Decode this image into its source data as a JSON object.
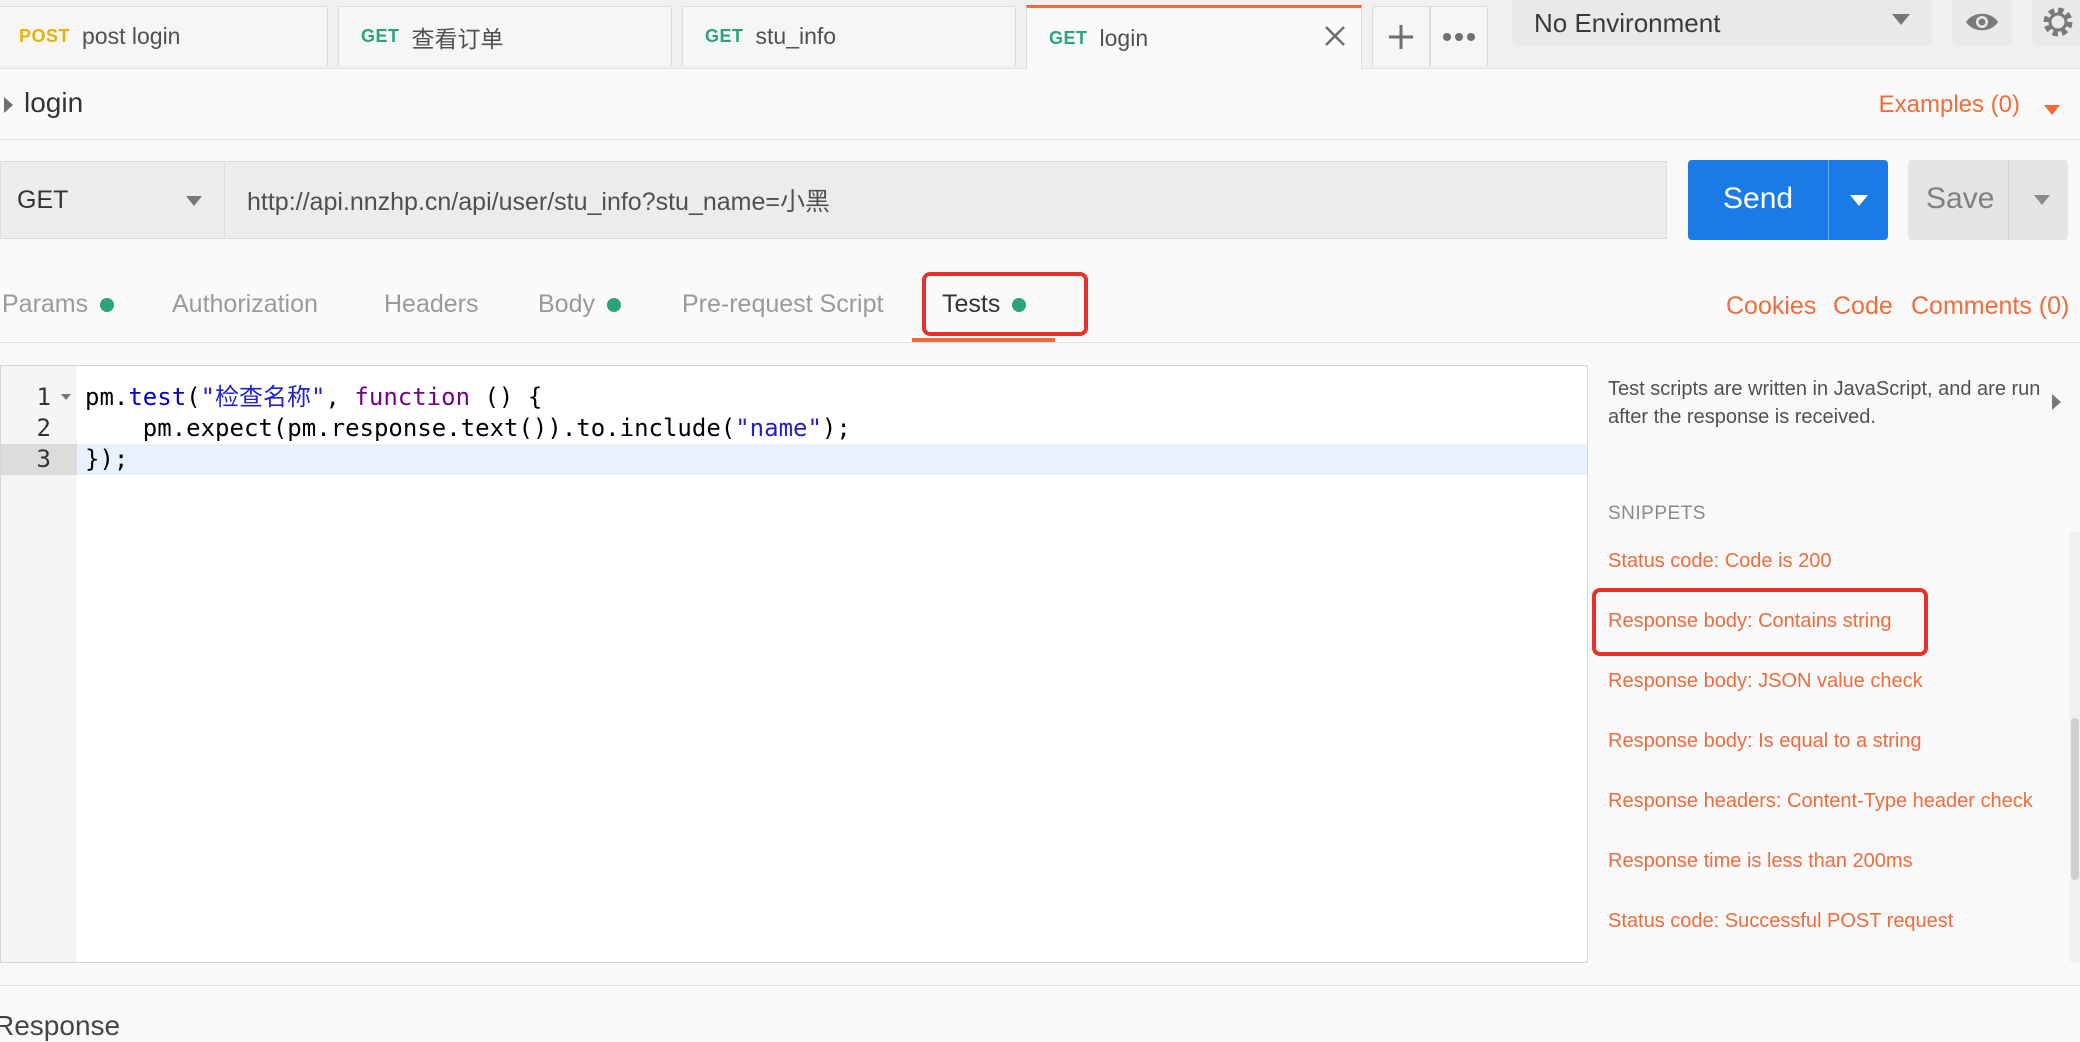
{
  "tabs": [
    {
      "method": "POST",
      "label": "post login"
    },
    {
      "method": "GET",
      "label": "查看订单"
    },
    {
      "method": "GET",
      "label": "stu_info"
    },
    {
      "method": "GET",
      "label": "login"
    }
  ],
  "environment": {
    "selected": "No Environment"
  },
  "request": {
    "title": "login",
    "examples_label": "Examples (0)",
    "method": "GET",
    "url": "http://api.nnzhp.cn/api/user/stu_info?stu_name=小黑",
    "send_label": "Send",
    "save_label": "Save"
  },
  "subtabs": {
    "params": "Params",
    "authorization": "Authorization",
    "headers": "Headers",
    "body": "Body",
    "prerequest": "Pre-request Script",
    "tests": "Tests",
    "cookies": "Cookies",
    "code": "Code",
    "comments": "Comments (0)"
  },
  "editor": {
    "line_numbers": [
      "1",
      "2",
      "3"
    ],
    "line1": {
      "obj": "pm.",
      "fn": "test",
      "open": "(",
      "str": "\"检查名称\"",
      "comma": ", ",
      "kw": "function",
      "rest": " () {"
    },
    "line2": {
      "pre": "    pm.expect(pm.response.text()).to.include(",
      "str": "\"name\"",
      "post": ");"
    },
    "line3": {
      "text": "});"
    }
  },
  "snippets": {
    "help": "Test scripts are written in JavaScript, and are run after the response is received.",
    "header": "SNIPPETS",
    "items": [
      "Status code: Code is 200",
      "Response body: Contains string",
      "Response body: JSON value check",
      "Response body: Is equal to a string",
      "Response headers: Content-Type header check",
      "Response time is less than 200ms",
      "Status code: Successful POST request"
    ]
  },
  "response": {
    "label": "Response"
  },
  "colors": {
    "accent": "#f26b3a",
    "send": "#1a7be6",
    "get": "#2ba47d",
    "post": "#e4b308",
    "highlight": "#e8312a"
  }
}
